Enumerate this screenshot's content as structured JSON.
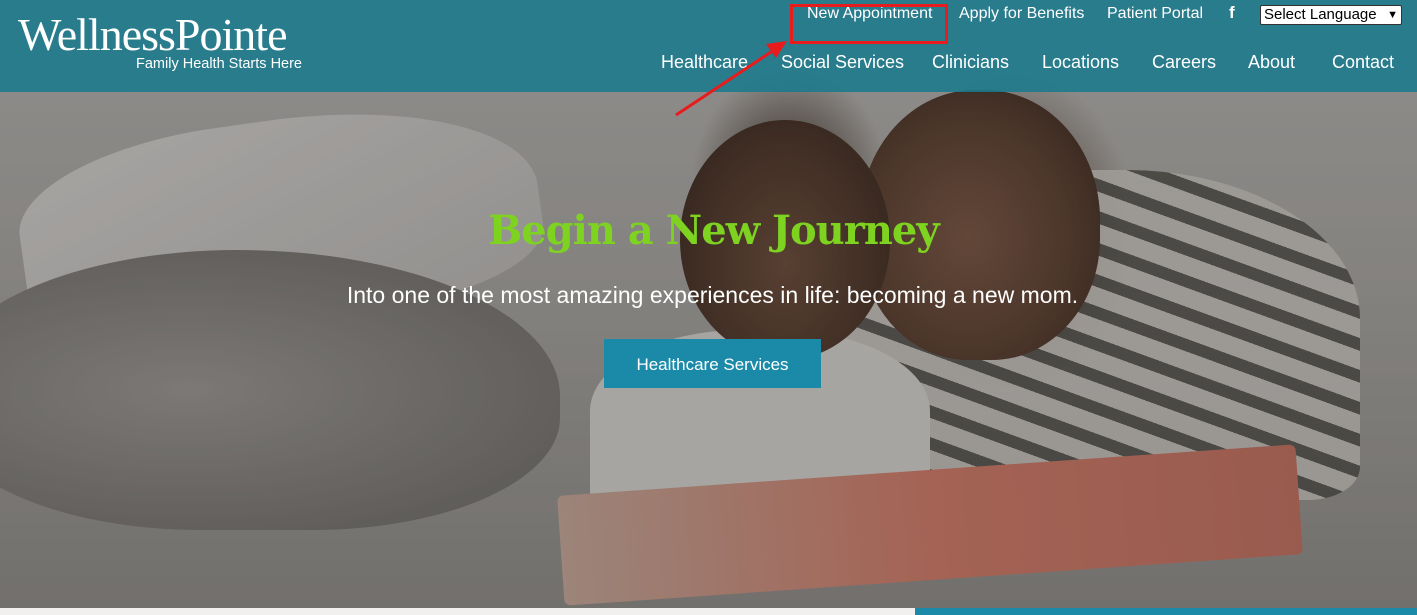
{
  "header": {
    "logo_name": "WellnessPointe",
    "logo_tagline": "Family Health Starts Here",
    "top_links": [
      "New Appointment",
      "Apply for Benefits",
      "Patient Portal"
    ],
    "facebook_icon": "f",
    "language_select": "Select Language",
    "main_nav": [
      "Healthcare",
      "Social Services",
      "Clinicians",
      "Locations",
      "Careers",
      "About",
      "Contact"
    ]
  },
  "hero": {
    "title": "Begin a New Journey",
    "subtitle": "Into one of the most amazing experiences in life: becoming a new mom.",
    "button": "Healthcare Services"
  },
  "colors": {
    "header_bg": "#1a7a8c",
    "title_green": "#7ed321",
    "button_bg": "#1a8aa8",
    "highlight_red": "#e81c1c"
  }
}
